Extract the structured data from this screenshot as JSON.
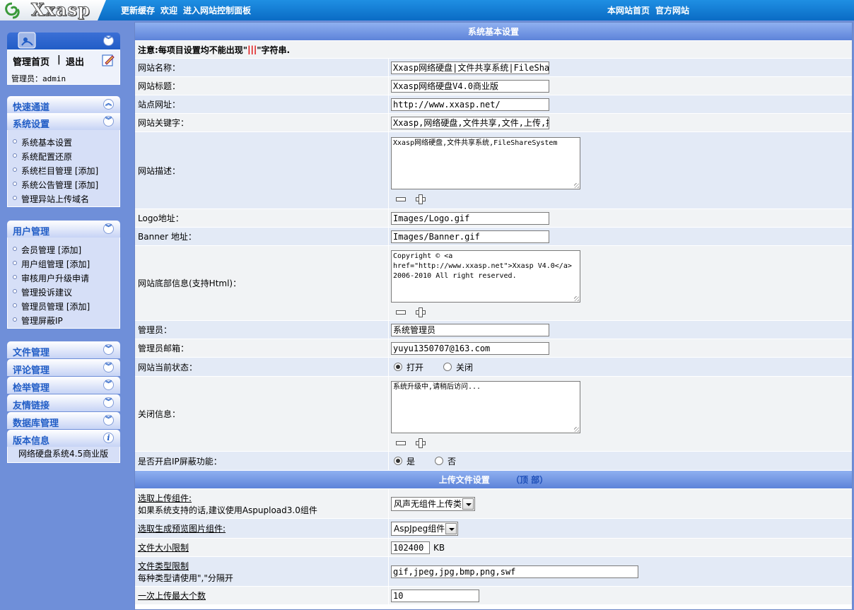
{
  "top": {
    "logo_text": "Xxasp",
    "links_left": [
      "更新缓存",
      "欢迎",
      "进入网站控制面板"
    ],
    "links_right": [
      "本网站首页",
      "官方网站"
    ]
  },
  "sidebar": {
    "admin_home": "管理首页",
    "sep": "|",
    "logout": "退出",
    "admin_label": "管理员：admin",
    "quick": "快速通道",
    "system_settings": {
      "title": "系统设置",
      "items": [
        "系统基本设置",
        "系统配置还原",
        "系统栏目管理 [添加]",
        "系统公告管理 [添加]",
        "管理异站上传域名"
      ]
    },
    "user_mgmt": {
      "title": "用户管理",
      "items": [
        "会员管理 [添加]",
        "用户组管理 [添加]",
        "审核用户升级申请",
        "管理投诉建议",
        "管理员管理  [添加]",
        "管理屏蔽IP"
      ]
    },
    "collapsed": [
      "文件管理",
      "评论管理",
      "检举管理",
      "友情链接",
      "数据库管理"
    ],
    "version": {
      "title": "版本信息",
      "text": "网络硬盘系统4.5商业版"
    }
  },
  "main": {
    "section1_title": "系统基本设置",
    "notice_pre": "注意:每项目设置均不能出现\"",
    "notice_mid": "|||",
    "notice_post": "\"字符串.",
    "site_name": {
      "label": "网站名称：",
      "value": "Xxasp网络硬盘|文件共享系统|FileShare S"
    },
    "site_title": {
      "label": "网站标题：",
      "value": "Xxasp网络硬盘V4.0商业版"
    },
    "site_url": {
      "label": "站点网址：",
      "value": "http://www.xxasp.net/"
    },
    "keywords": {
      "label": "网站关键字：",
      "value": "Xxasp,网络硬盘,文件共享,文件,上传,提取,"
    },
    "description": {
      "label": "网站描述：",
      "value": "Xxasp网络硬盘,文件共享系统,FileShareSystem"
    },
    "logo": {
      "label": "Logo地址：",
      "value": "Images/Logo.gif"
    },
    "banner": {
      "label": "Banner 地址：",
      "value": "Images/Banner.gif"
    },
    "footer": {
      "label": "网站底部信息(支持Html)：",
      "value": "Copyright © <a href=\"http://www.xxasp.net\">Xxasp V4.0</a> 2006-2010 All right reserved."
    },
    "admin": {
      "label": "管理员：",
      "value": "系统管理员"
    },
    "admin_email": {
      "label": "管理员邮箱：",
      "value": "yuyu1350707@163.com"
    },
    "status": {
      "label": "网站当前状态：",
      "opt_on": "打开",
      "opt_off": "关闭"
    },
    "close_info": {
      "label": "关闭信息：",
      "value": "系统升级中,请稍后访问..."
    },
    "ip_block": {
      "label": "是否开启IP屏蔽功能：",
      "opt_yes": "是",
      "opt_no": "否"
    },
    "section2_title": "上传文件设置",
    "section2_top": "（顶 部）",
    "upload_comp": {
      "label": "选取上传组件:",
      "hint": "如果系统支持的话,建议使用Aspupload3.0组件",
      "value": "风声无组件上传类"
    },
    "preview_comp": {
      "label": "选取生成预览图片组件:",
      "value": "AspJpeg组件"
    },
    "size_limit": {
      "label": "文件大小限制",
      "value": "102400",
      "unit": "KB"
    },
    "type_limit": {
      "label": "文件类型限制",
      "hint": "每种类型请使用\",\"分隔开",
      "value": "gif,jpeg,jpg,bmp,png,swf"
    },
    "max_upload": {
      "label": "一次上传最大个数",
      "value": "10"
    }
  }
}
